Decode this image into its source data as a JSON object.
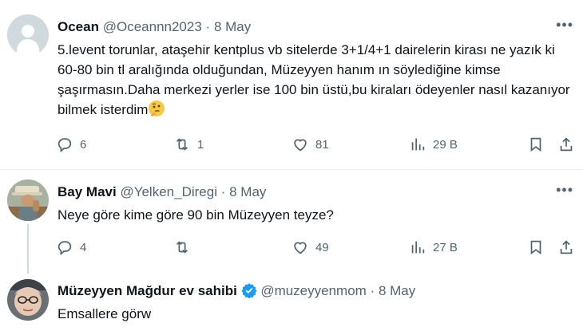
{
  "tweets": [
    {
      "name": "Ocean",
      "handle": "@Oceannn2023",
      "date": "8 May",
      "text": "5.levent torunlar, ataşehir kentplus vb sitelerde 3+1/4+1 dairelerin kirası ne yazık ki 60-80 bin tl aralığında olduğundan, Müzeyyen hanım ın söylediğine kimse şaşırmasın.Daha merkezi yerler ise 100 bin üstü,bu kiraları ödeyenler nasıl kazanıyor bilmek isterdim",
      "emoji": "thinking-face",
      "replies": "6",
      "retweets": "1",
      "likes": "81",
      "views": "29 B"
    },
    {
      "name": "Bay Mavi",
      "handle": "@Yelken_Diregi",
      "date": "8 May",
      "text": "Neye göre kime göre 90 bin Müzeyyen teyze?",
      "replies": "4",
      "retweets": "",
      "likes": "49",
      "views": "27 B"
    },
    {
      "name": "Müzeyyen Mağdur ev sahibi",
      "handle": "@muzeyyenmom",
      "date": "8 May",
      "text": "Emsallere görw",
      "verified": true
    }
  ],
  "separator": "·",
  "more_glyph": "•••",
  "colors": {
    "text": "#0f1419",
    "secondary": "#536471",
    "verified": "#1d9bf0",
    "thread_line": "#cfd9de"
  }
}
